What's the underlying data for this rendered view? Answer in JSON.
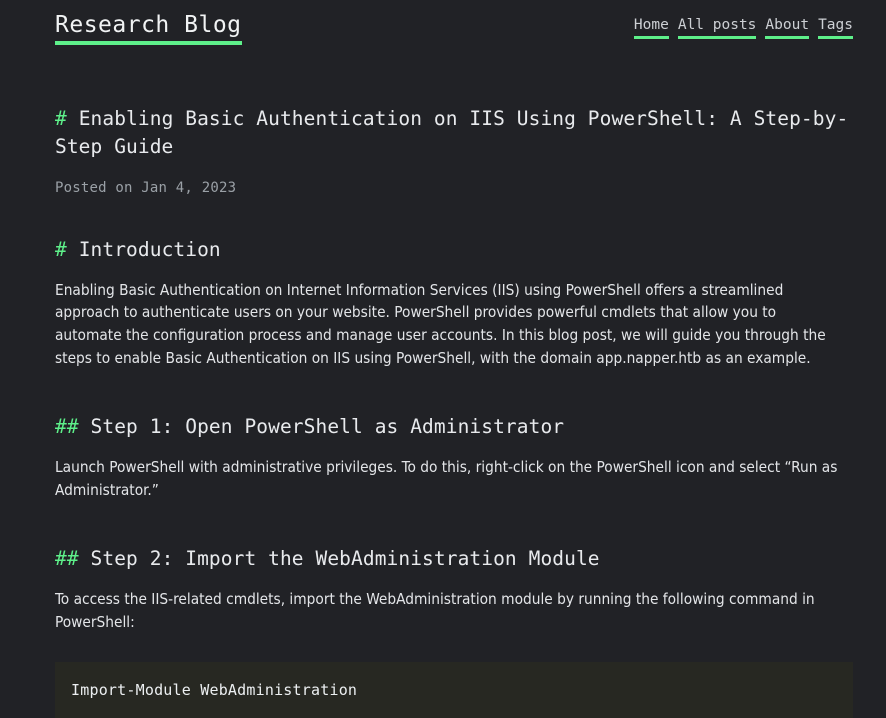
{
  "site": {
    "title": "Research Blog",
    "accent_color": "#5ef08a",
    "background_color": "#212226",
    "nav": [
      {
        "label": "Home"
      },
      {
        "label": "All posts"
      },
      {
        "label": "About"
      },
      {
        "label": "Tags"
      }
    ]
  },
  "post": {
    "hash_marker": "#",
    "title": "Enabling Basic Authentication on IIS Using PowerShell: A Step-by-Step Guide",
    "date_line": "Posted on Jan 4, 2023",
    "sections": [
      {
        "marker": "#",
        "heading": "Introduction",
        "paragraph": "Enabling Basic Authentication on Internet Information Services (IIS) using PowerShell offers a streamlined approach to authenticate users on your website. PowerShell provides powerful cmdlets that allow you to automate the configuration process and manage user accounts. In this blog post, we will guide you through the steps to enable Basic Authentication on IIS using PowerShell, with the domain app.napper.htb as an example."
      },
      {
        "marker": "##",
        "heading": "Step 1: Open PowerShell as Administrator",
        "paragraph": "Launch PowerShell with administrative privileges. To do this, right-click on the PowerShell icon and select “Run as Administrator.”"
      },
      {
        "marker": "##",
        "heading": "Step 2: Import the WebAdministration Module",
        "paragraph": "To access the IIS-related cmdlets, import the WebAdministration module by running the following command in PowerShell:",
        "code": "Import-Module WebAdministration"
      }
    ]
  }
}
